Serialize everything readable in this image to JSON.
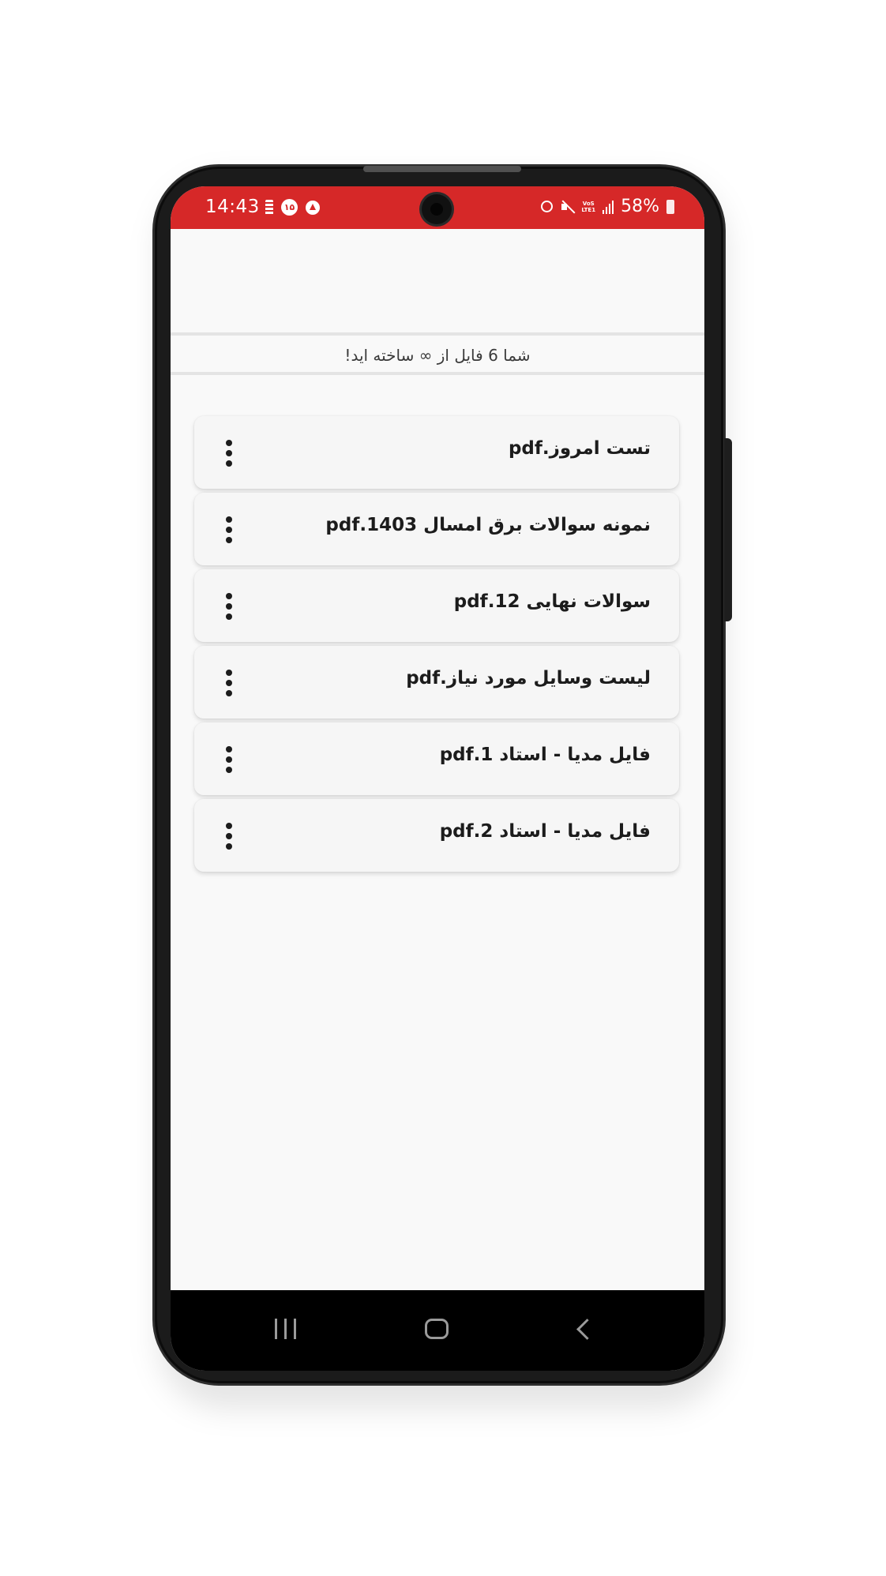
{
  "status_bar": {
    "time": "14:43",
    "left_icon_badge": "۱۵",
    "battery": "58%",
    "volte_top": "VoS",
    "volte_bottom": "LTE1",
    "color": "#d62828"
  },
  "info_bar": {
    "text": "شما 6 فایل از ∞ ساخته اید!"
  },
  "files": [
    {
      "name": "تست امروز.pdf",
      "menu_icon": "more-vert-icon"
    },
    {
      "name": "نمونه سوالات برق امسال 1403.pdf",
      "menu_icon": "more-vert-icon"
    },
    {
      "name": "سوالات نهایی 12.pdf",
      "menu_icon": "more-vert-icon"
    },
    {
      "name": "لیست وسایل مورد نیاز.pdf",
      "menu_icon": "more-vert-icon"
    },
    {
      "name": "فایل مدیا - استاد 1.pdf",
      "menu_icon": "more-vert-icon"
    },
    {
      "name": "فایل مدیا - استاد 2.pdf",
      "menu_icon": "more-vert-icon"
    }
  ],
  "nav_bar": {
    "icons": [
      "recents-icon",
      "home-icon",
      "back-icon"
    ]
  }
}
